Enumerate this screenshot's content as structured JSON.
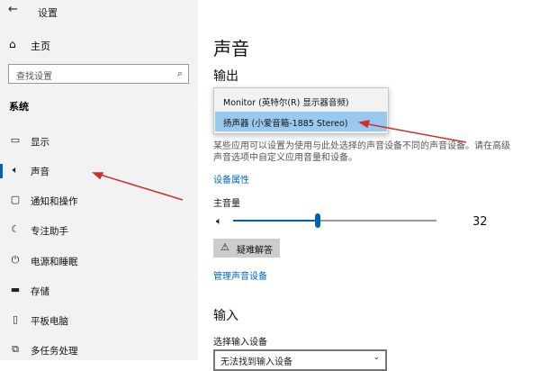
{
  "window": {
    "back_glyph": "←",
    "title": "设置"
  },
  "sidebar": {
    "home": {
      "label": "主页",
      "icon": "home-icon"
    },
    "search": {
      "placeholder": "查找设置",
      "icon": "search-icon"
    },
    "section_label": "系统",
    "items": [
      {
        "label": "显示",
        "icon": "display-icon",
        "selected": false
      },
      {
        "label": "声音",
        "icon": "speaker-icon",
        "selected": true
      },
      {
        "label": "通知和操作",
        "icon": "notifications-icon",
        "selected": false
      },
      {
        "label": "专注助手",
        "icon": "moon-icon",
        "selected": false
      },
      {
        "label": "电源和睡眠",
        "icon": "power-icon",
        "selected": false
      },
      {
        "label": "存储",
        "icon": "storage-icon",
        "selected": false
      },
      {
        "label": "平板电脑",
        "icon": "tablet-icon",
        "selected": false
      },
      {
        "label": "多任务处理",
        "icon": "multitasking-icon",
        "selected": false
      }
    ]
  },
  "main": {
    "title": "声音",
    "output_heading": "输出",
    "output_dropdown": {
      "options": [
        "Monitor (英特尔(R) 显示器音频)",
        "扬声器 (小爱音箱-1885 Stereo)"
      ],
      "selected_index": 1
    },
    "description": "某些应用可以设置为使用与此处选择的声音设备不同的声音设备。请在高级声音选项中自定义应用音量和设备。",
    "device_properties_link": "设备属性",
    "master_volume_label": "主音量",
    "volume": {
      "value": "32",
      "percent": 32
    },
    "troubleshoot_button": "疑难解答",
    "manage_devices_link": "管理声音设备",
    "input_heading": "输入",
    "input_device_label": "选择输入设备",
    "input_device_value": "无法找到输入设备"
  },
  "colors": {
    "accent": "#0063b1",
    "link": "#0067c0",
    "selection": "#99c9ef",
    "arrow": "#d42c2c"
  }
}
